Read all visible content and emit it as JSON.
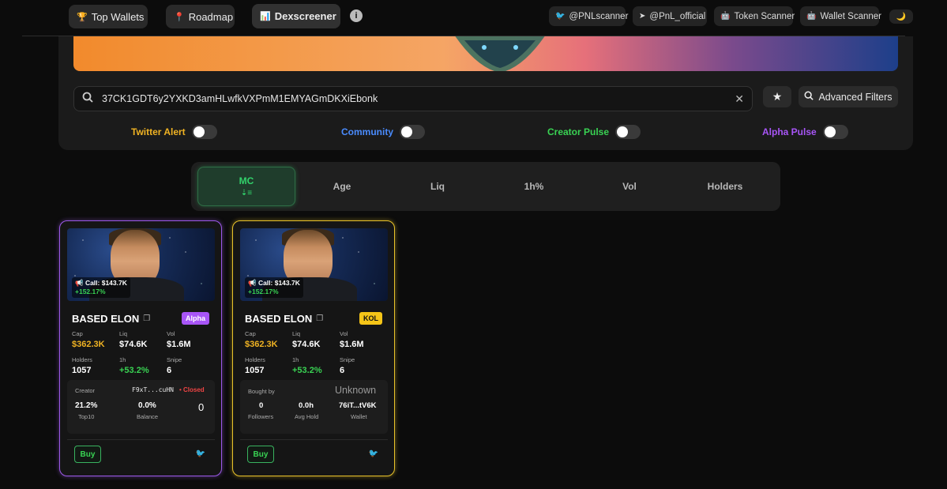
{
  "nav": {
    "top_wallets": "Top Wallets",
    "roadmap": "Roadmap",
    "dexscreener": "Dexscreener",
    "pnlscanner": "@PNLscanner",
    "pnl_official": "@PnL_official",
    "token_scanner": "Token Scanner",
    "wallet_scanner": "Wallet Scanner",
    "icons": {
      "trophy": "🏆",
      "pin": "📍",
      "chart": "📊",
      "twitter": "🐦",
      "telegram": "➤",
      "bot": "🤖",
      "moon": "🌙"
    }
  },
  "search": {
    "value": "37CK1GDT6y2YXKD3amHLwfkVXPmM1EMYAGmDKXiEbonk",
    "advanced_filters": "Advanced Filters"
  },
  "toggles": [
    {
      "label": "Twitter Alert",
      "color": "#f0b323"
    },
    {
      "label": "Community",
      "color": "#4a8cff"
    },
    {
      "label": "Creator Pulse",
      "color": "#39d353"
    },
    {
      "label": "Alpha Pulse",
      "color": "#a855f7"
    }
  ],
  "sort": {
    "items": [
      "MC",
      "Age",
      "Liq",
      "1h%",
      "Vol",
      "Holders"
    ],
    "active_arrow": "⇣≡"
  },
  "cards": [
    {
      "call": "📢 Call: $143.7K",
      "call_pct": "+152.17%",
      "name": "BASED ELON",
      "tag": "Alpha",
      "cap_label": "Cap",
      "cap": "$362.3K",
      "liq_label": "Liq",
      "liq": "$74.6K",
      "vol_label": "Vol",
      "vol": "$1.6M",
      "holders_label": "Holders",
      "holders": "1057",
      "h1_label": "1h",
      "h1": "+53.2%",
      "snipe_label": "Snipe",
      "snipe": "6",
      "creator_label": "Creator",
      "creator_addr": "F9xT...cuHN",
      "creator_status": "• Closed",
      "top10": "21.2%",
      "top10_label": "Top10",
      "balance": "0.0%",
      "balance_label": "Balance",
      "zero": "0",
      "buy": "Buy"
    },
    {
      "call": "📢 Call: $143.7K",
      "call_pct": "+152.17%",
      "name": "BASED ELON",
      "tag": "KOL",
      "cap_label": "Cap",
      "cap": "$362.3K",
      "liq_label": "Liq",
      "liq": "$74.6K",
      "vol_label": "Vol",
      "vol": "$1.6M",
      "holders_label": "Holders",
      "holders": "1057",
      "h1_label": "1h",
      "h1": "+53.2%",
      "snipe_label": "Snipe",
      "snipe": "6",
      "bought_by_label": "Bought by",
      "bought_by": "Unknown",
      "followers": "0",
      "followers_label": "Followers",
      "avg_hold": "0.0h",
      "avg_hold_label": "Avg Hold",
      "wallet": "76iT...tV6K",
      "wallet_label": "Wallet",
      "buy": "Buy"
    }
  ]
}
